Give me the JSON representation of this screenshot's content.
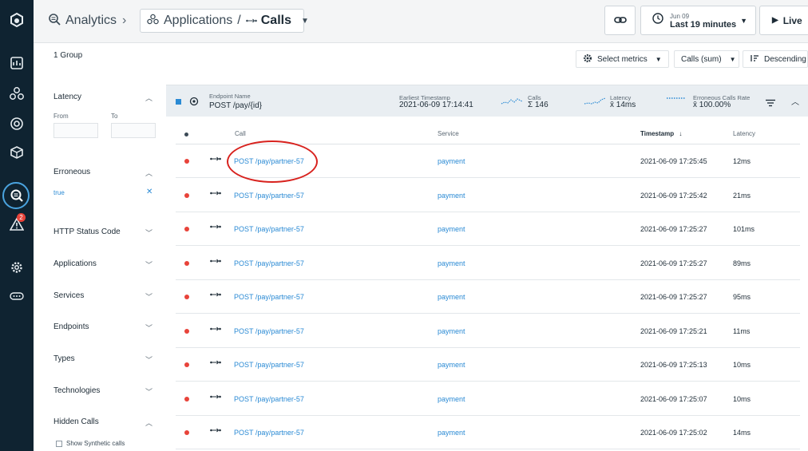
{
  "header": {
    "section": "Analytics",
    "crumb_app": "Applications",
    "crumb_calls": "Calls",
    "time_small": "Jun 09",
    "time_big": "Last 19 minutes",
    "live": "Live"
  },
  "sidebar": {
    "alert_count": "2"
  },
  "filters": {
    "groups": "1 Group",
    "latency": "Latency",
    "from": "From",
    "to": "To",
    "erroneous": "Erroneous",
    "erroneous_value": "true",
    "sections": [
      "HTTP Status Code",
      "Applications",
      "Services",
      "Endpoints",
      "Types",
      "Technologies",
      "Hidden Calls"
    ],
    "synthetic": "Show Synthetic calls"
  },
  "toolbar": {
    "select_metrics": "Select metrics",
    "calls_sum": "Calls (sum)",
    "descending": "Descending"
  },
  "group": {
    "endpoint_label": "Endpoint Name",
    "endpoint": "POST /pay/{id}",
    "earliest_label": "Earliest Timestamp",
    "earliest": "2021-06-09 17:14:41",
    "calls_label": "Calls",
    "calls": "Σ 146",
    "latency_label": "Latency",
    "latency": "x̄ 14ms",
    "err_label": "Erroneous Calls Rate",
    "err": "x̄ 100.00%"
  },
  "table": {
    "headers": {
      "call": "Call",
      "service": "Service",
      "timestamp": "Timestamp",
      "latency": "Latency"
    },
    "rows": [
      {
        "call": "POST /pay/partner-57",
        "service": "payment",
        "timestamp": "2021-06-09 17:25:45",
        "latency": "12ms"
      },
      {
        "call": "POST /pay/partner-57",
        "service": "payment",
        "timestamp": "2021-06-09 17:25:42",
        "latency": "21ms"
      },
      {
        "call": "POST /pay/partner-57",
        "service": "payment",
        "timestamp": "2021-06-09 17:25:27",
        "latency": "101ms"
      },
      {
        "call": "POST /pay/partner-57",
        "service": "payment",
        "timestamp": "2021-06-09 17:25:27",
        "latency": "89ms"
      },
      {
        "call": "POST /pay/partner-57",
        "service": "payment",
        "timestamp": "2021-06-09 17:25:27",
        "latency": "95ms"
      },
      {
        "call": "POST /pay/partner-57",
        "service": "payment",
        "timestamp": "2021-06-09 17:25:21",
        "latency": "11ms"
      },
      {
        "call": "POST /pay/partner-57",
        "service": "payment",
        "timestamp": "2021-06-09 17:25:13",
        "latency": "10ms"
      },
      {
        "call": "POST /pay/partner-57",
        "service": "payment",
        "timestamp": "2021-06-09 17:25:07",
        "latency": "10ms"
      },
      {
        "call": "POST /pay/partner-57",
        "service": "payment",
        "timestamp": "2021-06-09 17:25:02",
        "latency": "14ms"
      }
    ]
  },
  "icons": [
    "logo-icon",
    "dashboard-icon",
    "applications-icon",
    "services-icon",
    "infrastructure-icon",
    "analytics-icon",
    "alert-icon",
    "settings-icon",
    "more-icon",
    "link-icon",
    "clock-icon",
    "play-icon",
    "gear-icon",
    "sort-icon",
    "filter-icon",
    "calls-icon",
    "endpoint-icon"
  ],
  "colors": {
    "rail": "#0f2331",
    "accent": "#2a8ad4",
    "error": "#e8433a",
    "annotation": "#d8221e"
  }
}
